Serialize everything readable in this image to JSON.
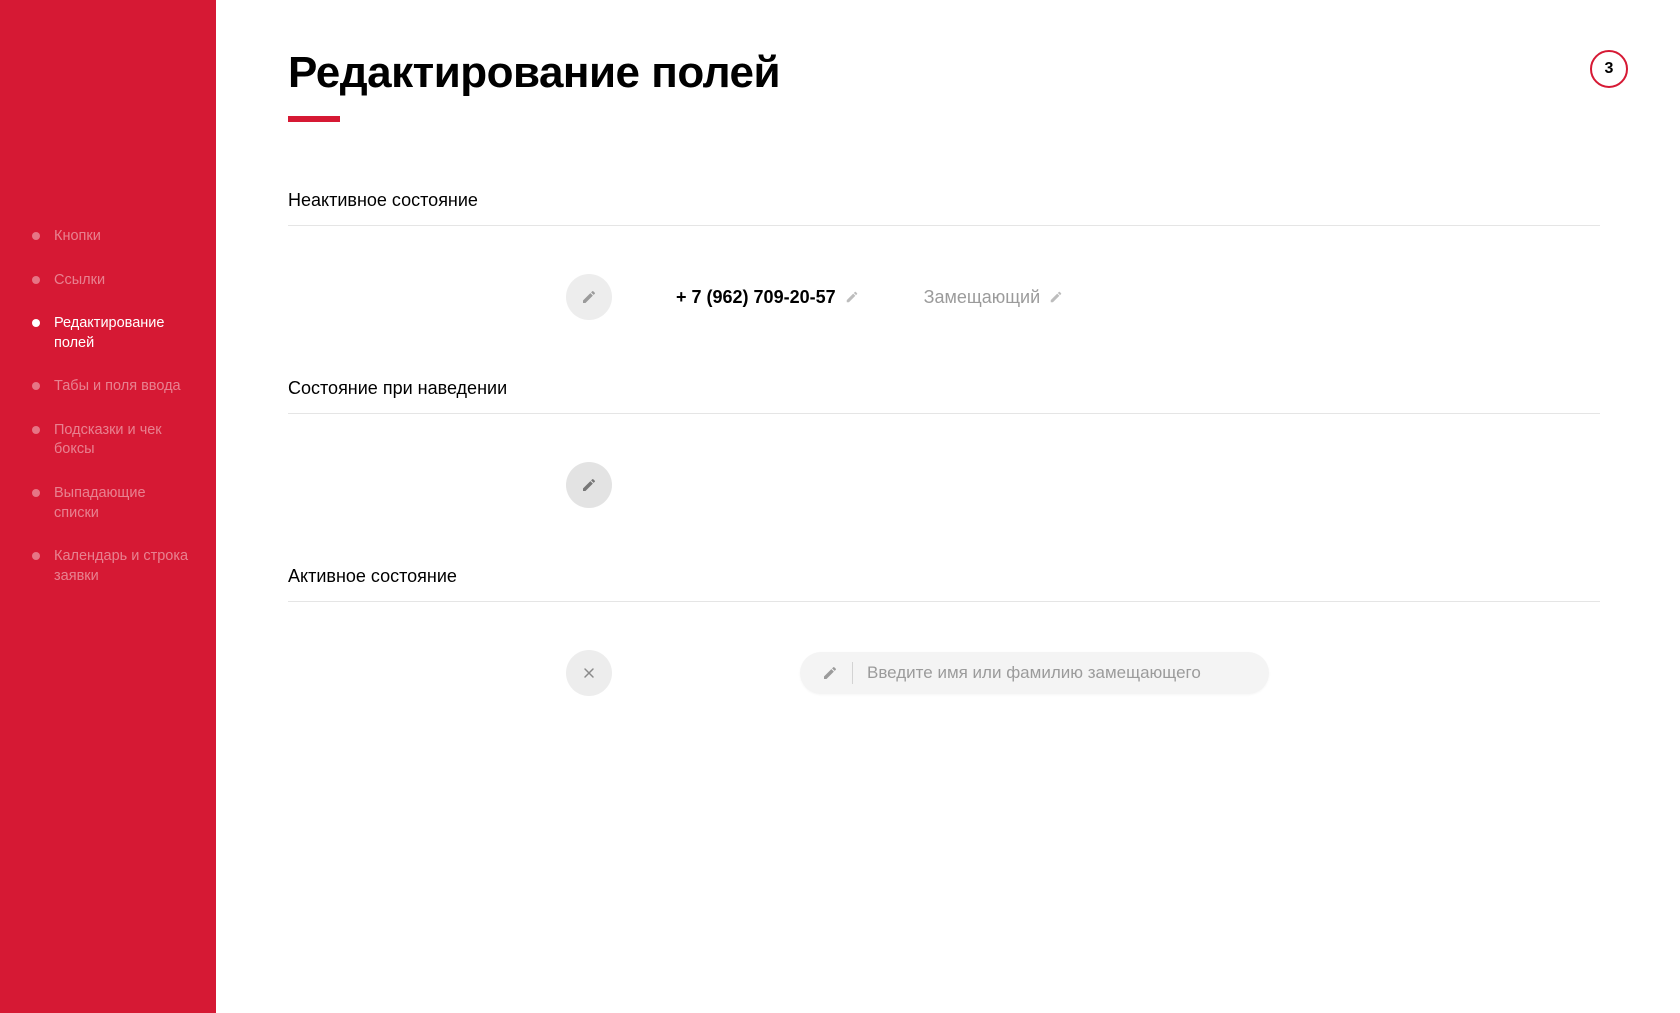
{
  "sidebar": {
    "items": [
      {
        "label": "Кнопки",
        "active": false
      },
      {
        "label": "Ссылки",
        "active": false
      },
      {
        "label": "Редактирование полей",
        "active": true
      },
      {
        "label": "Табы и поля ввода",
        "active": false
      },
      {
        "label": "Подсказки\nи чек боксы",
        "active": false
      },
      {
        "label": "Выпадающие списки",
        "active": false
      },
      {
        "label": "Календарь\nи строка заявки",
        "active": false
      }
    ]
  },
  "page": {
    "title": "Редактирование полей",
    "badge": "3"
  },
  "sections": {
    "inactive": {
      "title": "Неактивное состояние",
      "phone": "+ 7 (962) 709-20-57",
      "substitute_label": "Замещающий"
    },
    "hover": {
      "title": "Состояние при наведении"
    },
    "active": {
      "title": "Активное состояние",
      "placeholder": "Введите имя или фамилию замещающего"
    }
  },
  "colors": {
    "accent": "#d61934",
    "muted": "#9b9b9b"
  }
}
